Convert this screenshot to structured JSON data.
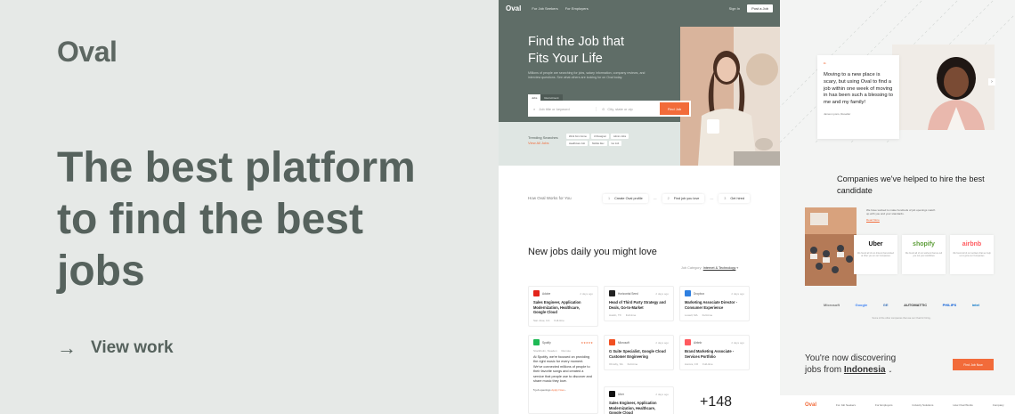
{
  "left": {
    "logo": "Oval",
    "headline": "The best platform to find the best jobs",
    "cta_arrow": "→",
    "cta_label": "View  work"
  },
  "site": {
    "nav": {
      "logo": "Oval",
      "link1": "For Job Seekers",
      "link2": "For Employers",
      "signin": "Sign In",
      "post": "Post a Job"
    },
    "hero_title": "Find the Job that Fits Your Life",
    "hero_sub": "Millions of people are searching for jobs, salary information, company reviews, and interview questions. See what others are looking for on Oval today.",
    "tab_jobs": "Jobs",
    "tab_other": "Recruitment",
    "search_placeholder": "Job title or keyword",
    "location_placeholder": "City, state or zip",
    "find_label": "Find Job",
    "trending_label": "Trending Searches",
    "trending_link": "View All Jobs",
    "chips": [
      "Work from home",
      "UI Designer",
      "Admin Jobs",
      "Healthcare Job",
      "Mobile Dev",
      "Go Job"
    ],
    "how_label": "How Oval Works for You",
    "steps": [
      {
        "num": "1",
        "label": "Create Oval profile"
      },
      {
        "num": "2",
        "label": "Find job you love"
      },
      {
        "num": "3",
        "label": "Get hired"
      }
    ],
    "newjobs": "New jobs daily you might love",
    "jobcat_label": "Job Category:",
    "jobcat_value": "Internet & Technology",
    "jobs": [
      {
        "company": "Adobe",
        "time": "2 days ago",
        "title": "Sales Engineer, Application Modernization, Healthcare, Google Cloud",
        "loc": "San Jose, CA",
        "type": "Full-time",
        "color": "#e3241b"
      },
      {
        "company": "Horizontal Seed",
        "time": "2 days ago",
        "title": "Head of Third Party Strategy and Deals, Go-to-Market",
        "loc": "Austin, TX",
        "type": "Full-time",
        "color": "#222222"
      },
      {
        "company": "Dropbox",
        "time": "2 days ago",
        "title": "Marketing Associate Director - Consumer Experience",
        "loc": "Lowell, MA",
        "type": "Full-time",
        "color": "#2f7fe0"
      },
      {
        "company": "Spotify",
        "time": "2 days ago",
        "title": "",
        "desc": "At Spotify, we're focused on providing the right music for every moment. We've connected millions of people to their favorite songs and created a service that people use to discover and share music they love.",
        "loc": "Stockholm, Sweden",
        "type": "Remote",
        "color": "#1db954",
        "rating": "★★★★★",
        "footer": "5 job openings",
        "footer_link": "Apply Now"
      },
      {
        "company": "Microsoft",
        "time": "2 days ago",
        "title": "G Suite Specialist, Google Cloud Customer Engineering",
        "loc": "Olmsby, SA",
        "type": "Full-time",
        "color": "#f25022"
      },
      {
        "company": "Airbnb",
        "time": "2 days ago",
        "title": "Brand Marketing Associate - Services Portfolio",
        "loc": "Aurora, CO",
        "type": "Full-time",
        "color": "#ff5a5f"
      },
      {
        "company": "Uber",
        "time": "2 days ago",
        "title": "Sales Engineer, Application Modernization, Healthcare, Google Cloud",
        "loc": "",
        "type": "",
        "color": "#111111"
      }
    ],
    "more": "+148"
  },
  "right": {
    "quote_mark": "“",
    "quote": "Moving to a new place is scary, but using Oval to find a job within one week of moving in has been such a blessing to me and my family!",
    "author": "James Lyons, Reseller",
    "companies_title": "Companies we've helped to hire the best candidate",
    "companies_desc": "We have worked to make hundreds of job openings match up with you and your standards.",
    "read_more": "Read More",
    "cards": [
      {
        "name": "Uber",
        "text": "We found all of our drivers that worked at Uber you on our Companies",
        "color": "#111111"
      },
      {
        "name": "shopify",
        "text": "We found all of our workers that we tell you not your workflows",
        "color": "#5e9e3a"
      },
      {
        "name": "airbnb",
        "text": "We found all of our workers that we help us to grow our Companies",
        "color": "#ff5a5f"
      }
    ],
    "logos": [
      "Microsoft",
      "Google",
      "GE",
      "AUTOMATTIC",
      "PHILIPS",
      "intel"
    ],
    "logos_caption": "Some of the other companies that use our Oval for hiring.",
    "discover_a": "You're now discovering",
    "discover_b": "jobs from",
    "country": "Indonesia",
    "find_jobs": "Find Job Now",
    "footer_logo": "Oval",
    "footer_links": [
      "For Job Seekers",
      "For Employers",
      "Industry Solutions",
      "How Oval Works",
      "Company"
    ]
  }
}
